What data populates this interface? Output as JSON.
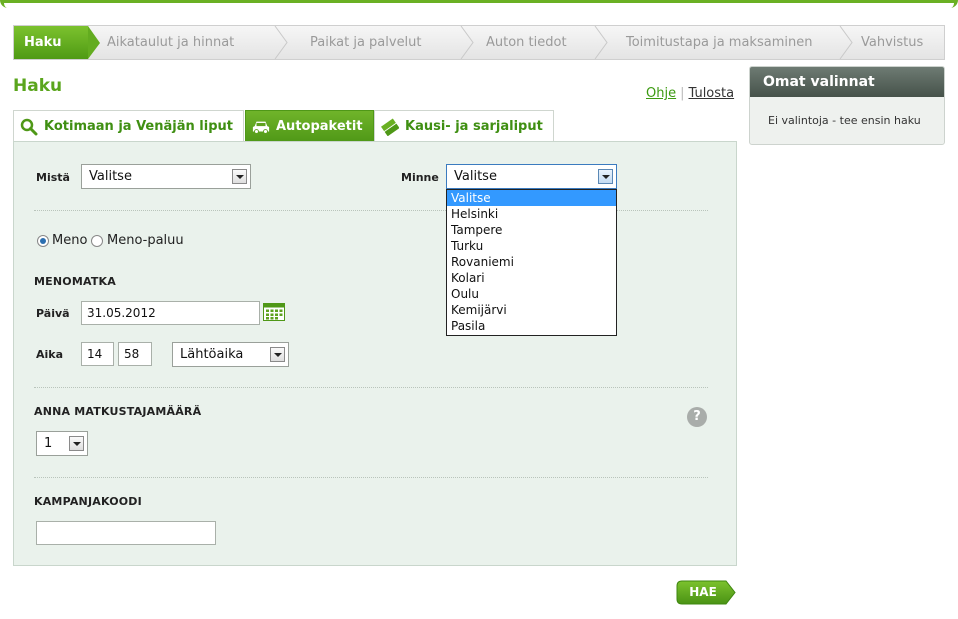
{
  "steps": {
    "active": "Haku",
    "items": [
      "Aikataulut ja hinnat",
      "Paikat ja palvelut",
      "Auton tiedot",
      "Toimitustapa ja maksaminen",
      "Vahvistus"
    ]
  },
  "page": {
    "title": "Haku",
    "help_link": "Ohje",
    "print_link": "Tulosta"
  },
  "tabs": [
    {
      "label": "Kotimaan ja Venäjän liput",
      "icon": "search-icon"
    },
    {
      "label": "Autopaketit",
      "icon": "car-icon"
    },
    {
      "label": "Kausi- ja sarjaliput",
      "icon": "tickets-icon"
    }
  ],
  "sidebar": {
    "title": "Omat valinnat",
    "empty_text": "Ei valintoja - tee ensin haku"
  },
  "form": {
    "from_label": "Mistä",
    "from_value": "Valitse",
    "to_label": "Minne",
    "to_value": "Valitse",
    "to_options": [
      "Valitse",
      "Helsinki",
      "Tampere",
      "Turku",
      "Rovaniemi",
      "Kolari",
      "Oulu",
      "Kemijärvi",
      "Pasila"
    ],
    "trip_oneway": "Meno",
    "trip_return": "Meno-paluu",
    "section_outbound": "MENOMATKA",
    "date_label": "Päivä",
    "date_value": "31.05.2012",
    "time_label": "Aika",
    "hour_value": "14",
    "minute_value": "58",
    "time_type_value": "Lähtöaika",
    "section_passengers": "ANNA MATKUSTAJAMÄÄRÄ",
    "passengers_value": "1",
    "help_glyph": "?",
    "section_campaign": "KAMPANJAKOODI",
    "campaign_value": "",
    "submit": "HAE"
  },
  "colors": {
    "brand_green": "#5aa51c",
    "form_bg": "#eaf2ec",
    "selected_option": "#3399ff"
  }
}
